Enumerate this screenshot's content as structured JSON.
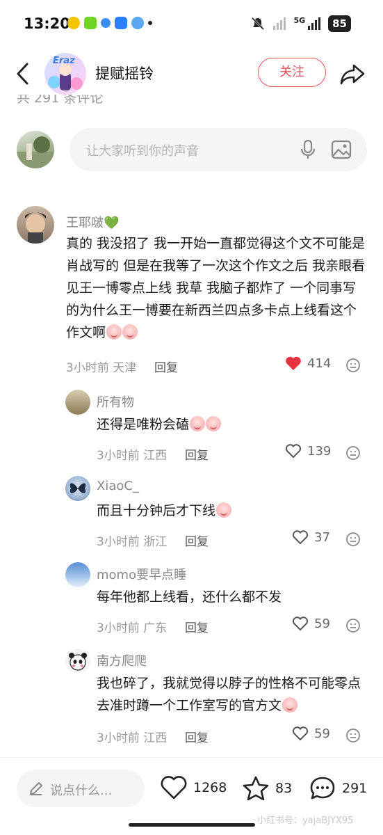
{
  "status_bar": {
    "time": "13:20",
    "battery": "85",
    "network": "5G"
  },
  "header": {
    "title": "提赋摇铃",
    "follow_label": "关注",
    "avatar_text": "Eraz"
  },
  "comment_count_partial": "共 291 条评论",
  "comment_input": {
    "placeholder": "让大家听到你的声音"
  },
  "comments": [
    {
      "name": "王耶啵💚",
      "text": "真的 我没招了 我一开始一直都觉得这个文不可能是肖战写的 但是在我等了一次这个作文之后 我亲眼看见王一博零点上线 我草 我脑子都炸了 一个同事写的为什么王一博要在新西兰四点多卡点上线看这个作文啊",
      "time": "3小时前",
      "location": "天津",
      "reply_label": "回复",
      "likes": "414",
      "liked": true
    },
    {
      "name": "所有物",
      "text": "还得是唯粉会磕",
      "time": "3小时前",
      "location": "江西",
      "reply_label": "回复",
      "likes": "139",
      "liked": false
    },
    {
      "name": "XiaoC_",
      "text": "而且十分钟后才下线",
      "time": "3小时前",
      "location": "浙江",
      "reply_label": "回复",
      "likes": "37",
      "liked": false
    },
    {
      "name": "momo要早点睡",
      "text": "每年他都上线看，还什么都不发",
      "time": "3小时前",
      "location": "广东",
      "reply_label": "回复",
      "likes": "59",
      "liked": false
    },
    {
      "name": "南方爬爬",
      "text": "我也碎了，我就觉得以脖子的性格不可能零点去准时蹲一个工作室写的官方文",
      "time": "3小时前",
      "location": "江西",
      "reply_label": "回复",
      "likes": "59",
      "liked": false
    }
  ],
  "bottom_bar": {
    "say_placeholder": "说点什么...",
    "likes": "1268",
    "favorites": "83",
    "comments": "291"
  },
  "watermark": "小红书号：yajaBJYX95",
  "colors": {
    "accent_red": "#e8505b",
    "like_red": "#e8333e"
  }
}
